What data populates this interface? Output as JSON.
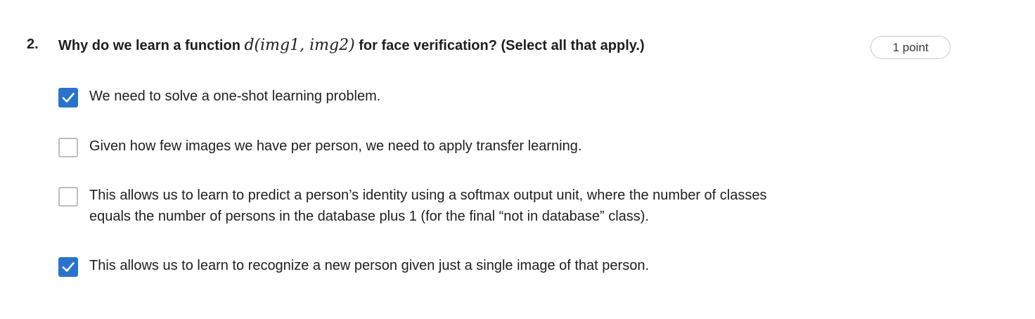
{
  "question": {
    "number": "2.",
    "text_before": "Why do we learn a function ",
    "math": "d(img1, img2)",
    "text_after": " for face verification? (Select all that apply.)",
    "points_label": "1 point"
  },
  "options": [
    {
      "label": "We need to solve a one-shot learning problem.",
      "checked": true
    },
    {
      "label": "Given how few images we have per person, we need to apply transfer learning.",
      "checked": false
    },
    {
      "label": "This allows us to learn to predict a person’s identity using a softmax output unit, where the number of classes equals the number of persons in the database plus 1 (for the final “not in database” class).",
      "checked": false
    },
    {
      "label": "This allows us to learn to recognize a new person given just a single image of that person.",
      "checked": true
    }
  ],
  "colors": {
    "checkbox_checked": "#2a73cc",
    "checkbox_unchecked_border": "#bdbdbd",
    "text": "#1f1f1f"
  }
}
